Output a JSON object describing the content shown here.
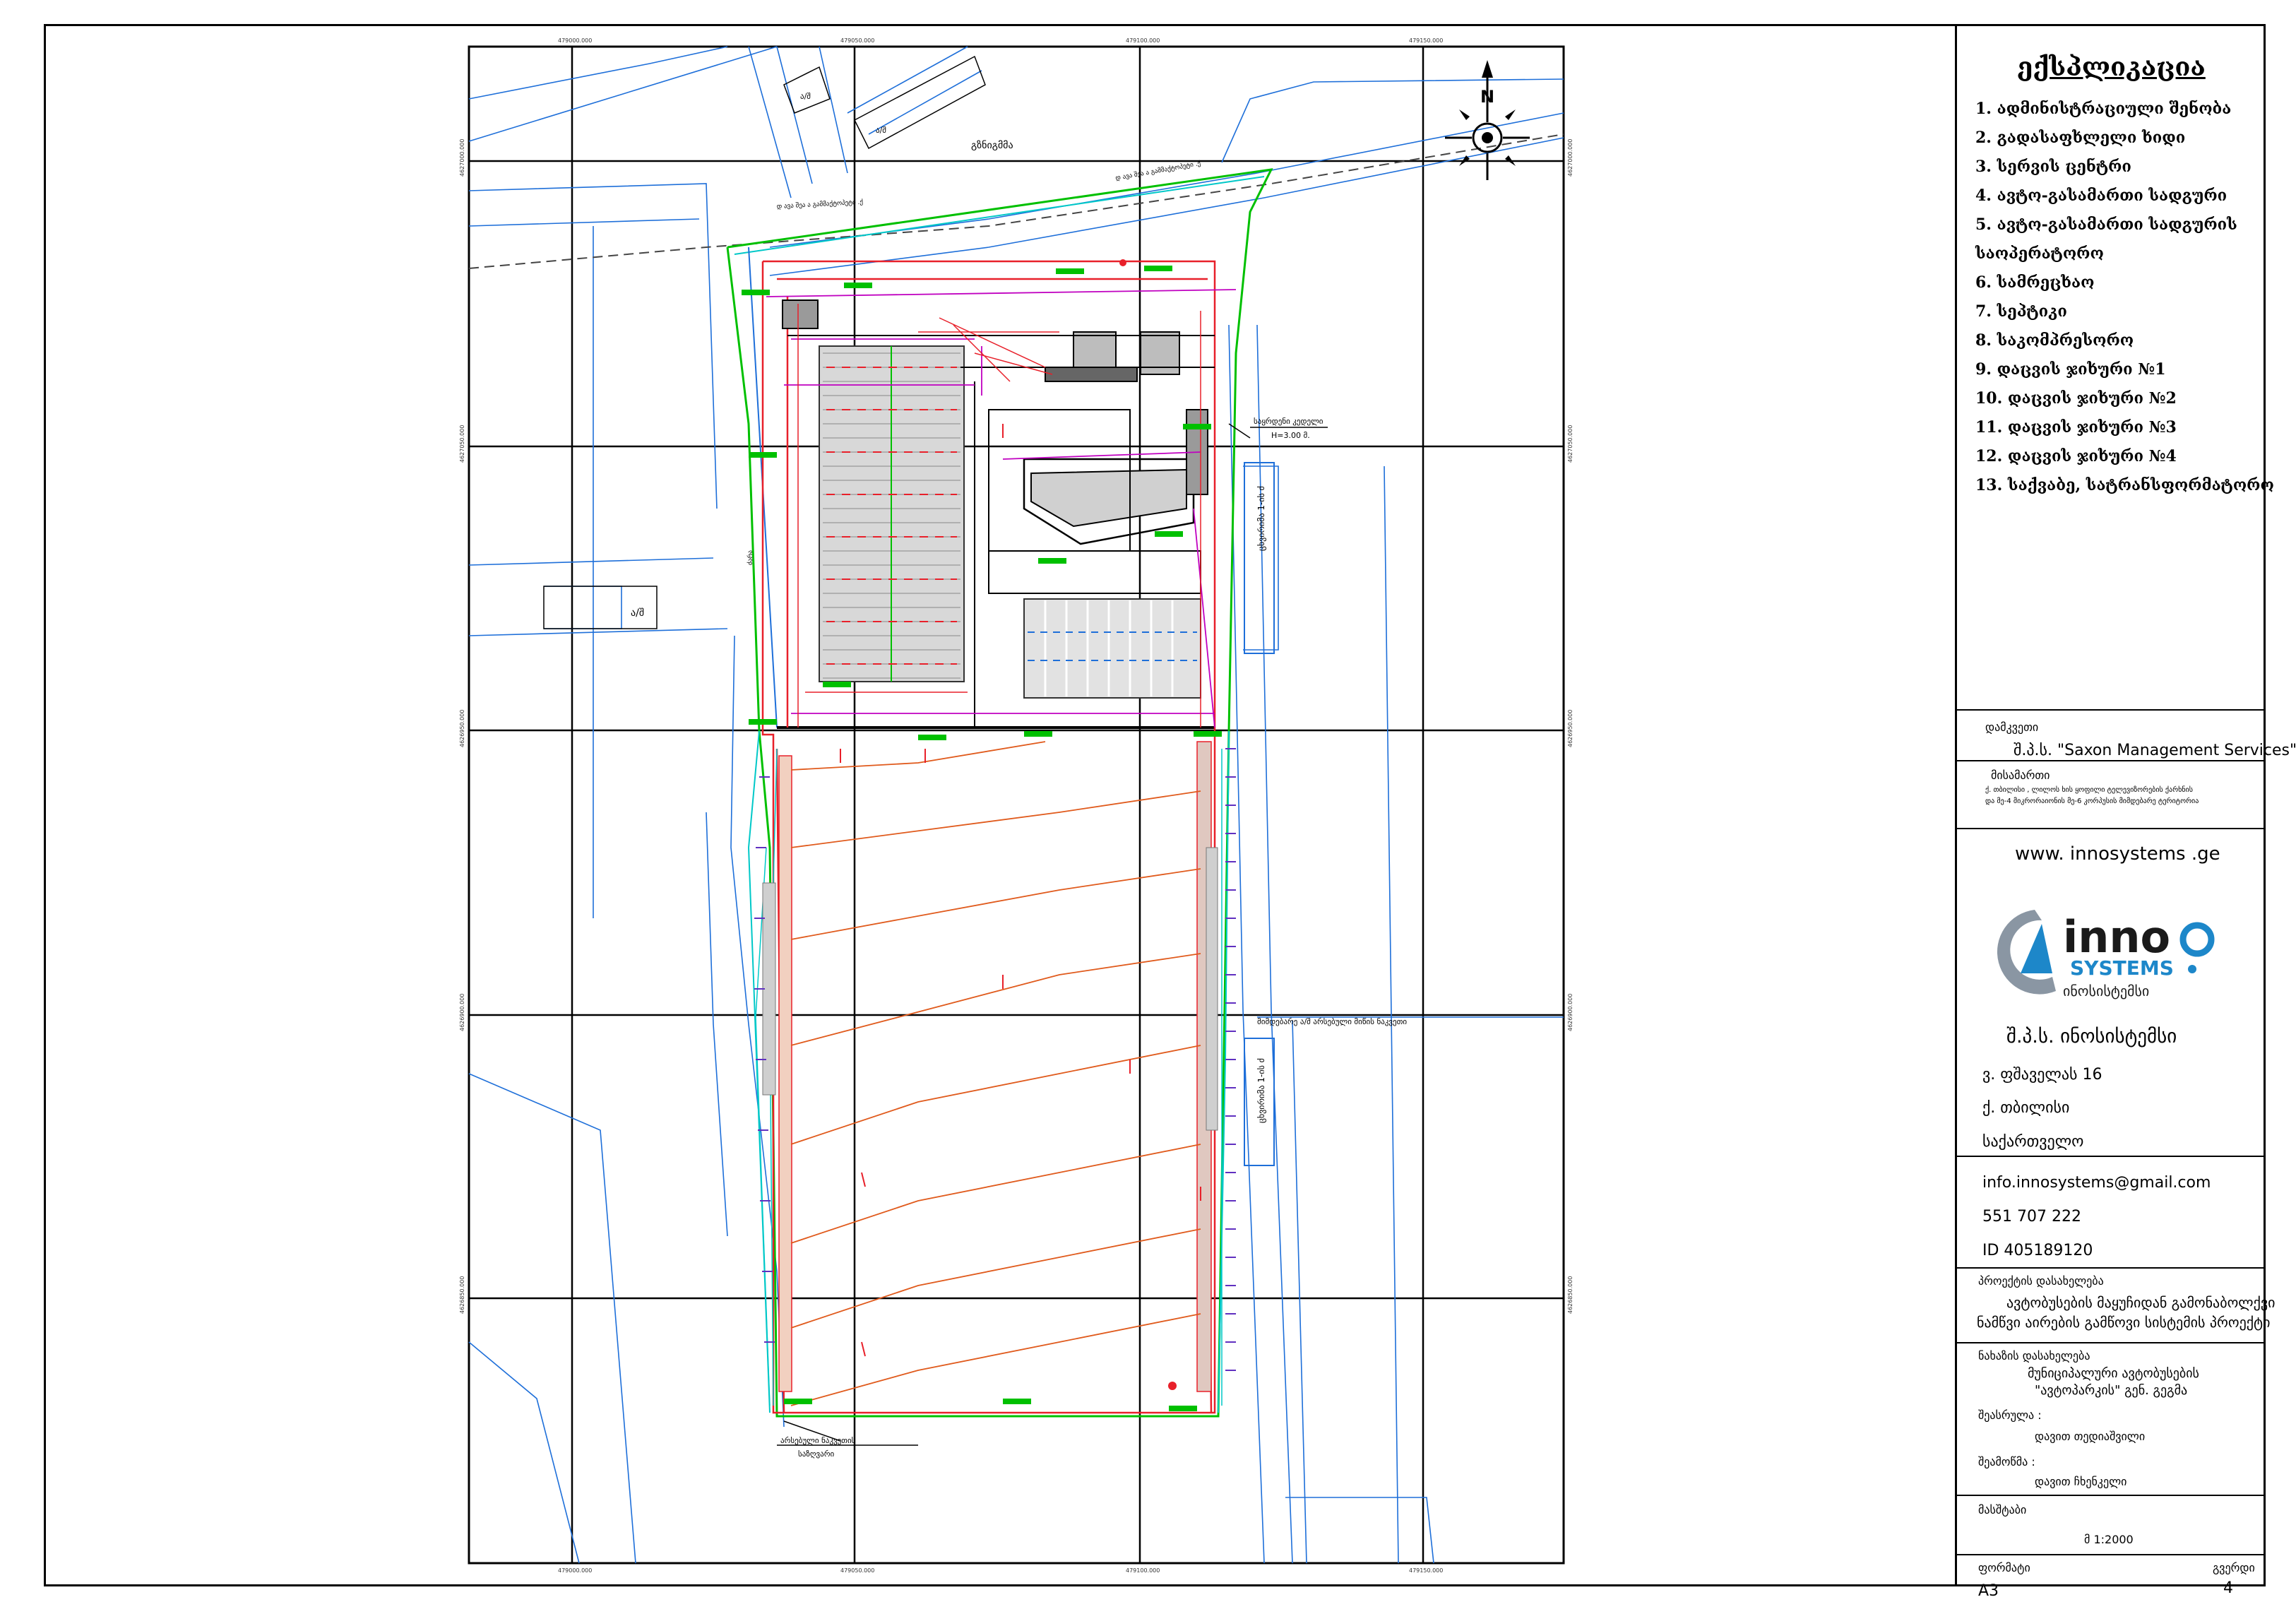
{
  "coordinates": {
    "top": [
      "479000.000",
      "479050.000",
      "479100.000",
      "479150.000"
    ],
    "bottom": [
      "479000.000",
      "479050.000",
      "479100.000",
      "479150.000"
    ],
    "left": [
      "4627000.000",
      "4627050.000",
      "4626950.000",
      "4626900.000",
      "4626850.000",
      "4626800.000"
    ],
    "right": [
      "4627000.000",
      "4627050.000",
      "4626950.000",
      "4626900.000",
      "4626850.000",
      "4626800.000"
    ]
  },
  "map_labels": {
    "building_a": "ა/შ",
    "building_b": "ა/შ",
    "building_c": "ა/შ",
    "street_top": "გზნიგმმა",
    "road_upper": "დ ავა შეა ა გამმაქტოპეტი .ქ",
    "road_lower": "დ ავა შეა ა გამმაქტოპეტი .ქ",
    "retaining_wall": "საყრდენი კედელი\nH=3.00 მ.",
    "channel_upper": "ცხვირიმა 1-ის ძ",
    "channel_lower": "ცხვირიმა 1-ის ძ",
    "neighbor_plot": "მიმდებარე ა/შ არსებული მიწის ნაკვეთი",
    "left_label": "ძარა",
    "boundary_note": "არსებული ნაკვეთის საზღვარი"
  },
  "legend": {
    "title": "ექსპლიკაცია",
    "items": [
      "1. ადმინისტრაციული შენობა",
      "2. გადასაფხლელი ხიდი",
      "3. სერვის ცენტრი",
      "4. ავტო-გასამართი სადგური",
      "5. ავტო-გასამართი სადგურის",
      "საოპერატორო",
      "6. სამრეცხაო",
      "7. სეპტიკი",
      "8. საკომპრესორო",
      "9. დაცვის ჯიხური №1",
      "10. დაცვის ჯიხური №2",
      "11. დაცვის ჯიხური №3",
      "12. დაცვის ჯიხური №4",
      "13. საქვაბე, სატრანსფორმატორო"
    ]
  },
  "title_block": {
    "client_label": "დამკვეთი",
    "client_value": "შ.პ.ს. \"Saxon Management Services\"",
    "address_label": "მისამართი",
    "address_line1": "ქ. თბილისი , ლილოს ხის ყოფილი ტელევიზორების ქარხნის",
    "address_line2": "და მე-4 მიკრორაიონის მე-6 კორპუსის მიმდებარე ტერიტორია",
    "website": "www. innosystems .ge",
    "logo_text_inno": "inno",
    "logo_text_systems": "SYSTEMS",
    "logo_text_geo": "ინოსისტემსი",
    "company": "შ.პ.ს. ინოსისტემსი",
    "street": "ვ. ფშაველას 16",
    "city": "ქ. თბილისი",
    "country": "საქართველო",
    "email": "info.innosystems@gmail.com",
    "phone": "551 707 222",
    "id": "ID 405189120",
    "project_label": "პროექტის დასახელება",
    "project_line1": "ავტობუსების მაყუჩიდან გამონაბოლქვი",
    "project_line2": "ნამწვი აირების გამწოვი სისტემის პროექტი",
    "drawing_label": "ნახაზის დასახელება",
    "drawing_line1": "მუნიციპალური ავტობუსების",
    "drawing_line2": "\"ავტოპარკის\" გენ. გეგმა",
    "performed_label": "შეასრულა :",
    "performed_value": "დავით თედიაშვილი",
    "checked_label": "შეამოწმა :",
    "checked_value": "დავით ჩხენკელი",
    "scale_label": "მასშტაბი",
    "scale_value": "მ 1:2000",
    "format_label": "ფორმატი",
    "format_value": "A3",
    "page_label": "გვერდი",
    "page_value": "4"
  },
  "colors": {
    "boundary": "#e8202a",
    "road": "#1e6fd9",
    "grid": "#000000",
    "green": "#00c000",
    "magenta": "#c000c0",
    "cyan": "#00c8c8",
    "orange": "#e05a1c",
    "gray": "#8c8c8c",
    "logo_blue": "#1d87c9",
    "logo_gray": "#8a96a3"
  }
}
